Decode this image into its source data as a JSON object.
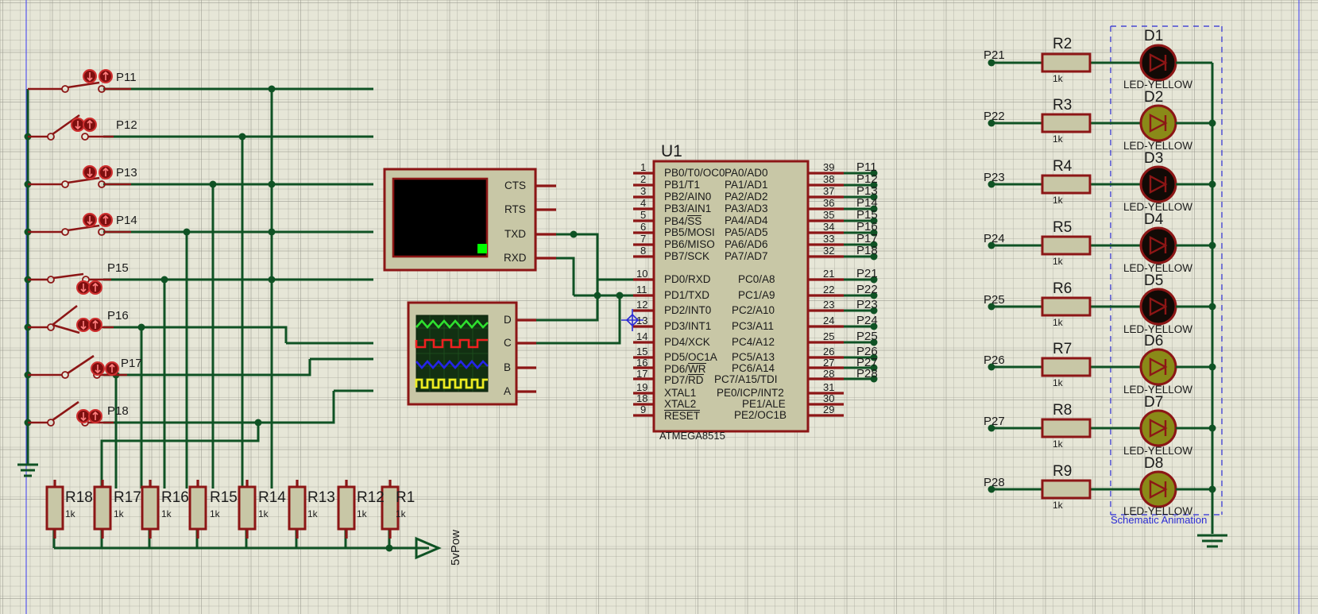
{
  "app": {
    "kind": "proteus-schematic-capture",
    "colors": {
      "wire": "#0f5224",
      "body": "#c8c7a6",
      "outline": "#8c1616",
      "grid": "#96968c",
      "background": "#e6e6d7",
      "annotation": "#2b2bd4",
      "led_on": "#8a8a18",
      "led_off": "#120a06",
      "terminal_screen": "#000000",
      "cursor": "#00ff00"
    }
  },
  "mcu": {
    "refdes": "U1",
    "part": "ATMEGA8515",
    "left_pins": [
      {
        "num": "1",
        "name": "PB0/T0/OC0"
      },
      {
        "num": "2",
        "name": "PB1/T1"
      },
      {
        "num": "3",
        "name": "PB2/AIN0"
      },
      {
        "num": "4",
        "name": "PB3/AIN1"
      },
      {
        "num": "5",
        "name": "PB4/SS",
        "overbar": "SS"
      },
      {
        "num": "6",
        "name": "PB5/MOSI"
      },
      {
        "num": "7",
        "name": "PB6/MISO"
      },
      {
        "num": "8",
        "name": "PB7/SCK"
      },
      {
        "num": "10",
        "name": "PD0/RXD"
      },
      {
        "num": "11",
        "name": "PD1/TXD"
      },
      {
        "num": "12",
        "name": "PD2/INT0"
      },
      {
        "num": "13",
        "name": "PD3/INT1"
      },
      {
        "num": "14",
        "name": "PD4/XCK"
      },
      {
        "num": "15",
        "name": "PD5/OC1A"
      },
      {
        "num": "16",
        "name": "PD6/WR",
        "overbar": "WR"
      },
      {
        "num": "17",
        "name": "PD7/RD",
        "overbar": "RD"
      },
      {
        "num": "19",
        "name": "XTAL1"
      },
      {
        "num": "18",
        "name": "XTAL2"
      },
      {
        "num": "9",
        "name": "RESET",
        "overbar": "RESET"
      }
    ],
    "right_pins": [
      {
        "num": "39",
        "name": "PA0/AD0",
        "net": "P11"
      },
      {
        "num": "38",
        "name": "PA1/AD1",
        "net": "P12"
      },
      {
        "num": "37",
        "name": "PA2/AD2",
        "net": "P13"
      },
      {
        "num": "36",
        "name": "PA3/AD3",
        "net": "P14"
      },
      {
        "num": "35",
        "name": "PA4/AD4",
        "net": "P15"
      },
      {
        "num": "34",
        "name": "PA5/AD5",
        "net": "P16"
      },
      {
        "num": "33",
        "name": "PA6/AD6",
        "net": "P17"
      },
      {
        "num": "32",
        "name": "PA7/AD7",
        "net": "P18"
      },
      {
        "num": "21",
        "name": "PC0/A8",
        "net": "P21"
      },
      {
        "num": "22",
        "name": "PC1/A9",
        "net": "P22"
      },
      {
        "num": "23",
        "name": "PC2/A10",
        "net": "P23"
      },
      {
        "num": "24",
        "name": "PC3/A11",
        "net": "P24"
      },
      {
        "num": "25",
        "name": "PC4/A12",
        "net": "P25"
      },
      {
        "num": "26",
        "name": "PC5/A13",
        "net": "P26"
      },
      {
        "num": "27",
        "name": "PC6/A14",
        "net": "P27"
      },
      {
        "num": "28",
        "name": "PC7/A15/TDI",
        "net": "P28"
      },
      {
        "num": "31",
        "name": "PE0/ICP/INT2"
      },
      {
        "num": "30",
        "name": "PE1/ALE"
      },
      {
        "num": "29",
        "name": "PE2/OC1B"
      }
    ]
  },
  "switches": [
    {
      "net": "P11",
      "closed": true
    },
    {
      "net": "P12",
      "closed": false
    },
    {
      "net": "P13",
      "closed": true
    },
    {
      "net": "P14",
      "closed": true
    },
    {
      "net": "P15",
      "closed": true
    },
    {
      "net": "P16",
      "closed": false
    },
    {
      "net": "P17",
      "closed": false
    },
    {
      "net": "P18",
      "closed": false
    }
  ],
  "pulldown_resistors": [
    {
      "refdes": "R18",
      "value": "1k"
    },
    {
      "refdes": "R17",
      "value": "1k"
    },
    {
      "refdes": "R16",
      "value": "1k"
    },
    {
      "refdes": "R15",
      "value": "1k"
    },
    {
      "refdes": "R14",
      "value": "1k"
    },
    {
      "refdes": "R13",
      "value": "1k"
    },
    {
      "refdes": "R12",
      "value": "1k"
    },
    {
      "refdes": "R1",
      "value": "1k"
    }
  ],
  "power_terminal": {
    "label": "5vPow"
  },
  "led_branches": [
    {
      "net": "P21",
      "resistor": "R2",
      "value": "1k",
      "led": "D1",
      "device": "LED-YELLOW",
      "on": false
    },
    {
      "net": "P22",
      "resistor": "R3",
      "value": "1k",
      "led": "D2",
      "device": "LED-YELLOW",
      "on": true
    },
    {
      "net": "P23",
      "resistor": "R4",
      "value": "1k",
      "led": "D3",
      "device": "LED-YELLOW",
      "on": false
    },
    {
      "net": "P24",
      "resistor": "R5",
      "value": "1k",
      "led": "D4",
      "device": "LED-YELLOW",
      "on": false
    },
    {
      "net": "P25",
      "resistor": "R6",
      "value": "1k",
      "led": "D5",
      "device": "LED-YELLOW",
      "on": false
    },
    {
      "net": "P26",
      "resistor": "R7",
      "value": "1k",
      "led": "D6",
      "device": "LED-YELLOW",
      "on": true
    },
    {
      "net": "P27",
      "resistor": "R8",
      "value": "1k",
      "led": "D7",
      "device": "LED-YELLOW",
      "on": true
    },
    {
      "net": "P28",
      "resistor": "R9",
      "value": "1k",
      "led": "D8",
      "device": "LED-YELLOW",
      "on": true
    }
  ],
  "selection": {
    "label": "Schematic Animation"
  },
  "virtual_terminal": {
    "pins": [
      "CTS",
      "RTS",
      "TXD",
      "RXD"
    ]
  },
  "oscilloscope": {
    "channels": [
      "D",
      "C",
      "B",
      "A"
    ],
    "traces": [
      {
        "channel": "D",
        "color": "#2ee02e",
        "shape": "triangle"
      },
      {
        "channel": "C",
        "color": "#ef2020",
        "shape": "square"
      },
      {
        "channel": "B",
        "color": "#2424e8",
        "shape": "triangle"
      },
      {
        "channel": "A",
        "color": "#ecec22",
        "shape": "square"
      }
    ]
  }
}
